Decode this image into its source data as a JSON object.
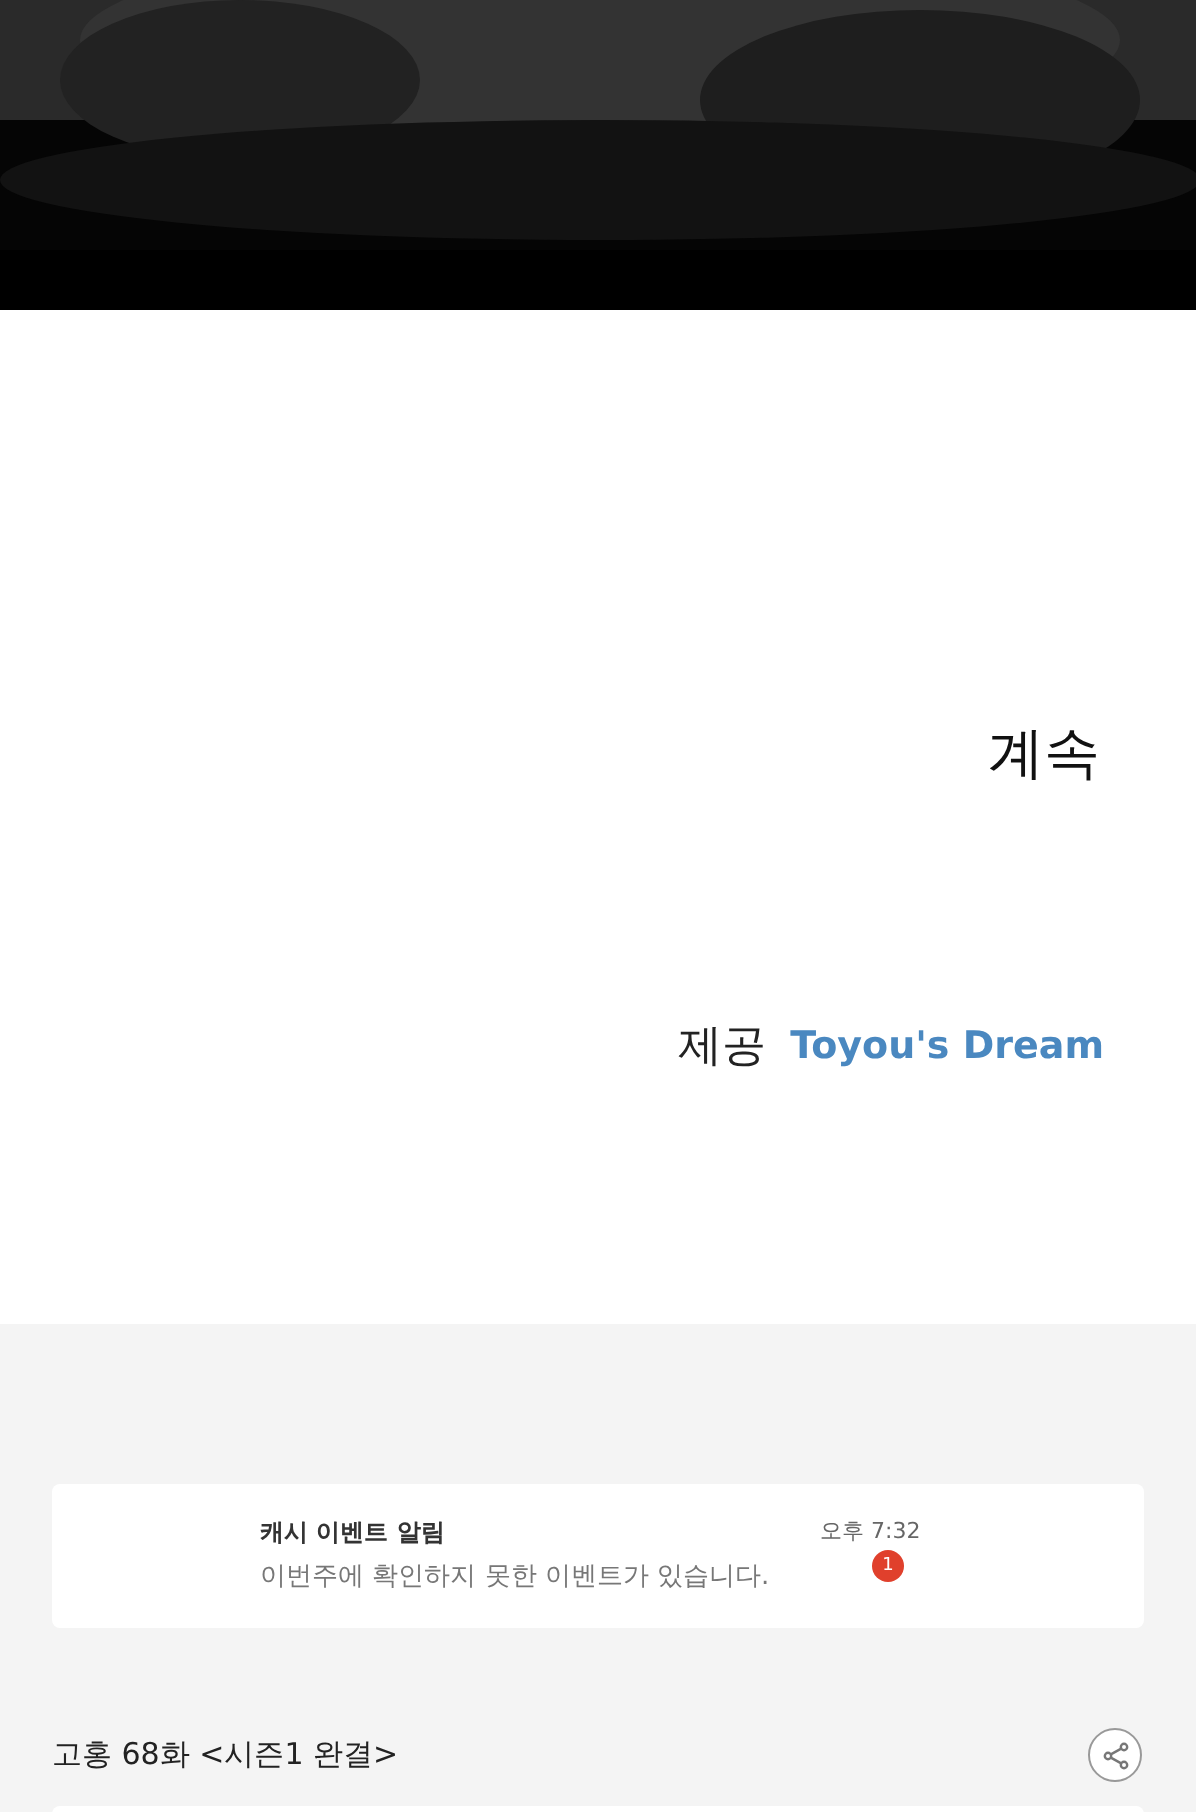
{
  "comic": {
    "continued": "계속",
    "credit_label": "제공",
    "publisher": "Toyou's Dream"
  },
  "notification": {
    "title": "캐시 이벤트 알림",
    "message": "이번주에 확인하지 못한 이벤트가 있습니다.",
    "time": "오후 7:32",
    "badge": "1"
  },
  "episode": {
    "title": "고홍 68화 <시즌1 완결>"
  }
}
